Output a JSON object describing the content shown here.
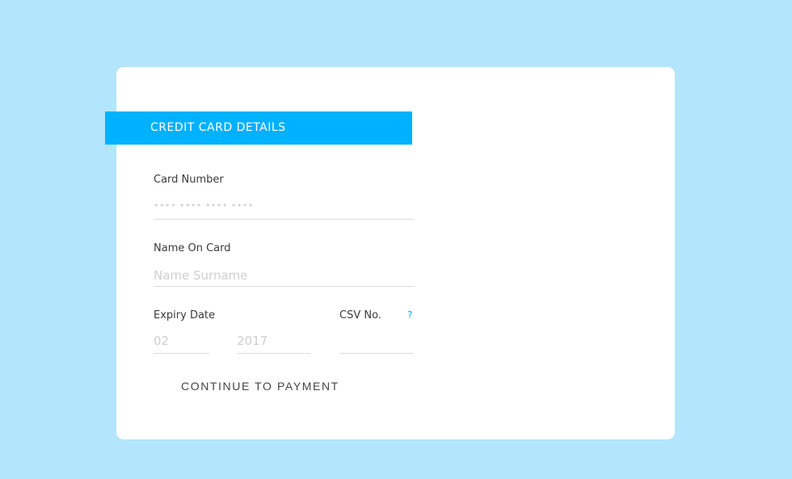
{
  "header": {
    "title": "CREDIT CARD DETAILS"
  },
  "form": {
    "card_number": {
      "label": "Card Number",
      "placeholder": "•••• •••• •••• ••••",
      "value": ""
    },
    "name_on_card": {
      "label": "Name On Card",
      "placeholder": "Name Surname",
      "value": ""
    },
    "expiry": {
      "label": "Expiry Date",
      "month_placeholder": "02",
      "year_placeholder": "2017"
    },
    "csv": {
      "label": "CSV No.",
      "help": "?",
      "placeholder": ""
    },
    "submit_label": "CONTINUE TO PAYMENT"
  },
  "colors": {
    "background": "#b3e5fc",
    "accent": "#00b1ff",
    "help": "#03a9f4"
  }
}
